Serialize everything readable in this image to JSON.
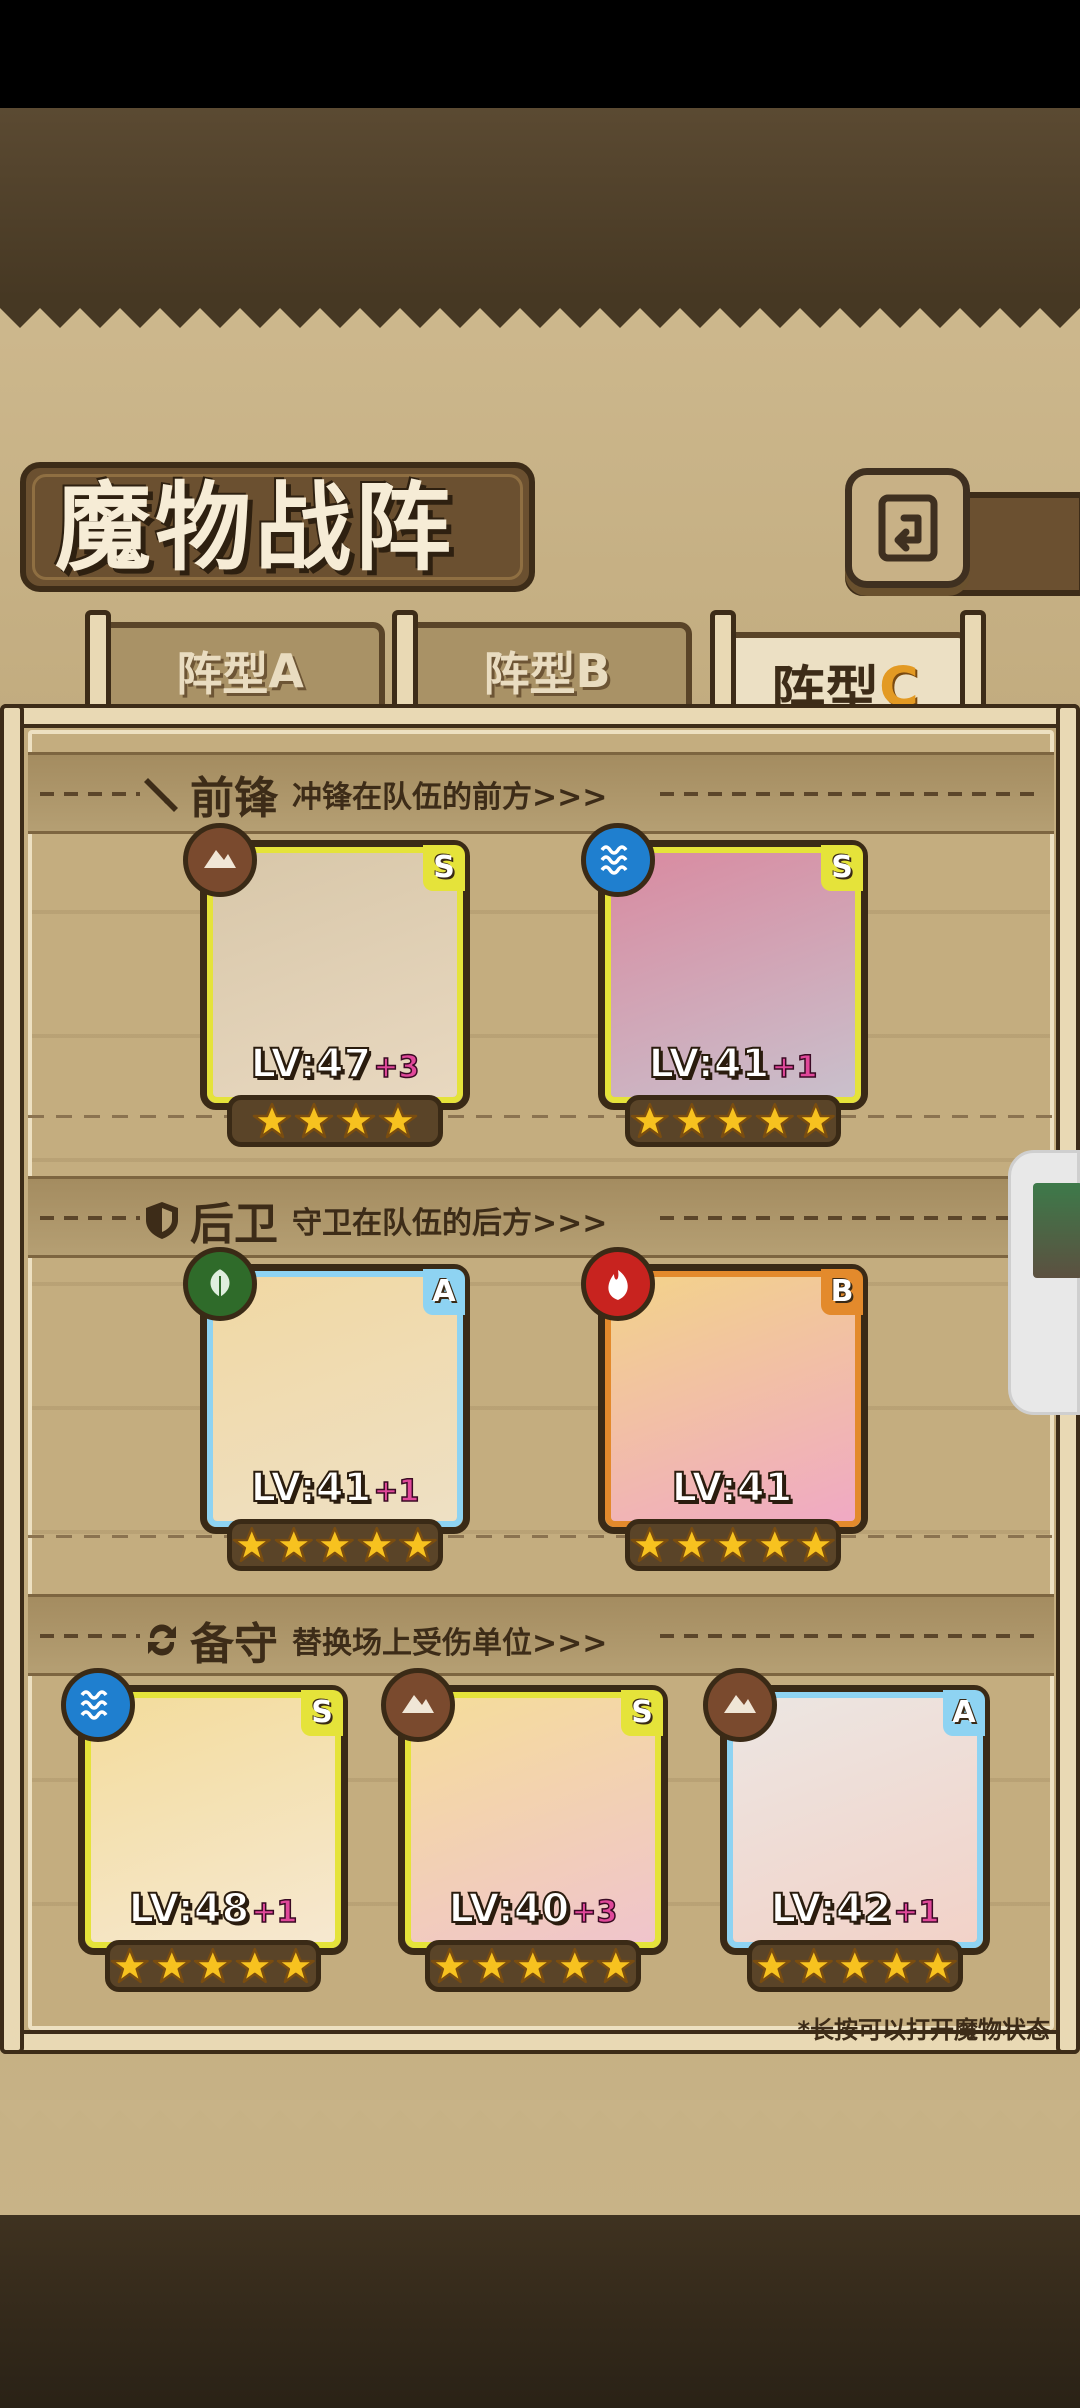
{
  "screen": {
    "title": "魔物战阵",
    "back_icon": "return-arrow-icon",
    "hint": "*长按可以打开魔物状态"
  },
  "tabs": [
    {
      "label": "阵型",
      "letter": "A",
      "active": false
    },
    {
      "label": "阵型",
      "letter": "B",
      "active": false
    },
    {
      "label": "阵型",
      "letter": "C",
      "active": true
    }
  ],
  "sections": {
    "front": {
      "name": "前锋",
      "desc": "冲锋在队伍的前方>>>",
      "icon": "sword-icon"
    },
    "rear": {
      "name": "后卫",
      "desc": "守卫在队伍的后方>>>",
      "icon": "shield-icon"
    },
    "reserve": {
      "name": "备守",
      "desc": "替换场上受伤单位>>>",
      "icon": "swap-icon"
    }
  },
  "cards": {
    "front": [
      {
        "lv": "LV:47",
        "plus": "+3",
        "grade": "S",
        "element": "earth",
        "stars": 4,
        "colors": [
          "#d8c7a9",
          "#e8d8c0"
        ]
      },
      {
        "lv": "LV:41",
        "plus": "+1",
        "grade": "S",
        "element": "water",
        "stars": 5,
        "colors": [
          "#d98aa0",
          "#c9c0cc"
        ]
      }
    ],
    "rear": [
      {
        "lv": "LV:41",
        "plus": "+1",
        "grade": "A",
        "element": "wood",
        "stars": 5,
        "colors": [
          "#f1d8a3",
          "#eee0c4"
        ]
      },
      {
        "lv": "LV:41",
        "plus": "",
        "grade": "B",
        "element": "fire",
        "stars": 5,
        "colors": [
          "#f3d38a",
          "#f0a9c4"
        ]
      }
    ],
    "reserve": [
      {
        "lv": "LV:48",
        "plus": "+1",
        "grade": "S",
        "element": "water",
        "stars": 5,
        "colors": [
          "#f3dc9c",
          "#f6e8d0"
        ]
      },
      {
        "lv": "LV:40",
        "plus": "+3",
        "grade": "S",
        "element": "earth",
        "stars": 5,
        "colors": [
          "#f5dd9a",
          "#f0c4cc"
        ]
      },
      {
        "lv": "LV:42",
        "plus": "+1",
        "grade": "A",
        "element": "earth",
        "stars": 5,
        "colors": [
          "#ece6e2",
          "#f2d2c8"
        ]
      }
    ]
  },
  "element_colors": {
    "earth": "#7a4a2e",
    "water": "#1f7fcf",
    "wood": "#2f6b2a",
    "fire": "#c8231f"
  }
}
